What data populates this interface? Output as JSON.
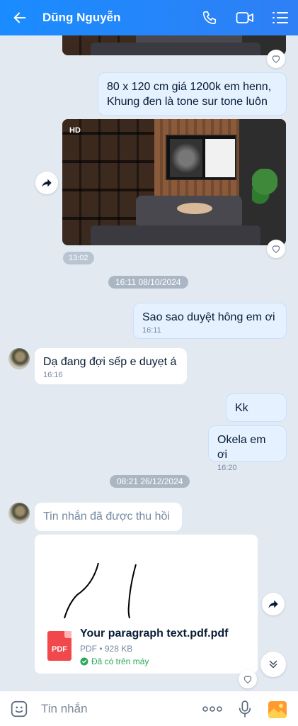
{
  "header": {
    "contact_name": "Dũng Nguyễn",
    "bg_color": "#1a8cff"
  },
  "messages": {
    "me_price": {
      "line1": "80 x 120 cm giá 1200k em henn,",
      "line2": "Khung đen là tone sur tone luôn"
    },
    "photo": {
      "hd_label": "HD",
      "time": "13:02"
    },
    "date_chip_1": "16:11 08/10/2024",
    "me_approve": {
      "text": "Sao sao duyệt hông em ơi",
      "time": "16:11"
    },
    "them_wait": {
      "text": "Dạ đang đợi sếp e duyẹt á",
      "time": "16:16"
    },
    "me_kk": {
      "text": "Kk"
    },
    "me_okela": {
      "text": "Okela em ơi",
      "time": "16:20"
    },
    "date_chip_2": "08:21 26/12/2024",
    "them_recalled": {
      "text": "Tin nhắn đã được thu hồi"
    },
    "file": {
      "icon_label": "PDF",
      "name": "Your paragraph text.pdf.pdf",
      "meta": "PDF • 928 KB",
      "status": "Đã có trên máy"
    }
  },
  "input": {
    "placeholder": "Tin nhắn"
  },
  "icons": [
    "back-arrow-icon",
    "phone-icon",
    "video-call-icon",
    "menu-list-icon",
    "heart-icon",
    "forward-icon",
    "scroll-down-icon",
    "sticker-icon",
    "more-icon",
    "microphone-icon",
    "image-icon"
  ],
  "colors": {
    "my_bubble": "#e5f1ff",
    "their_bubble": "#ffffff",
    "chat_bg": "#e2e9f1",
    "success": "#2ba85c",
    "pdf": "#f1484c"
  }
}
